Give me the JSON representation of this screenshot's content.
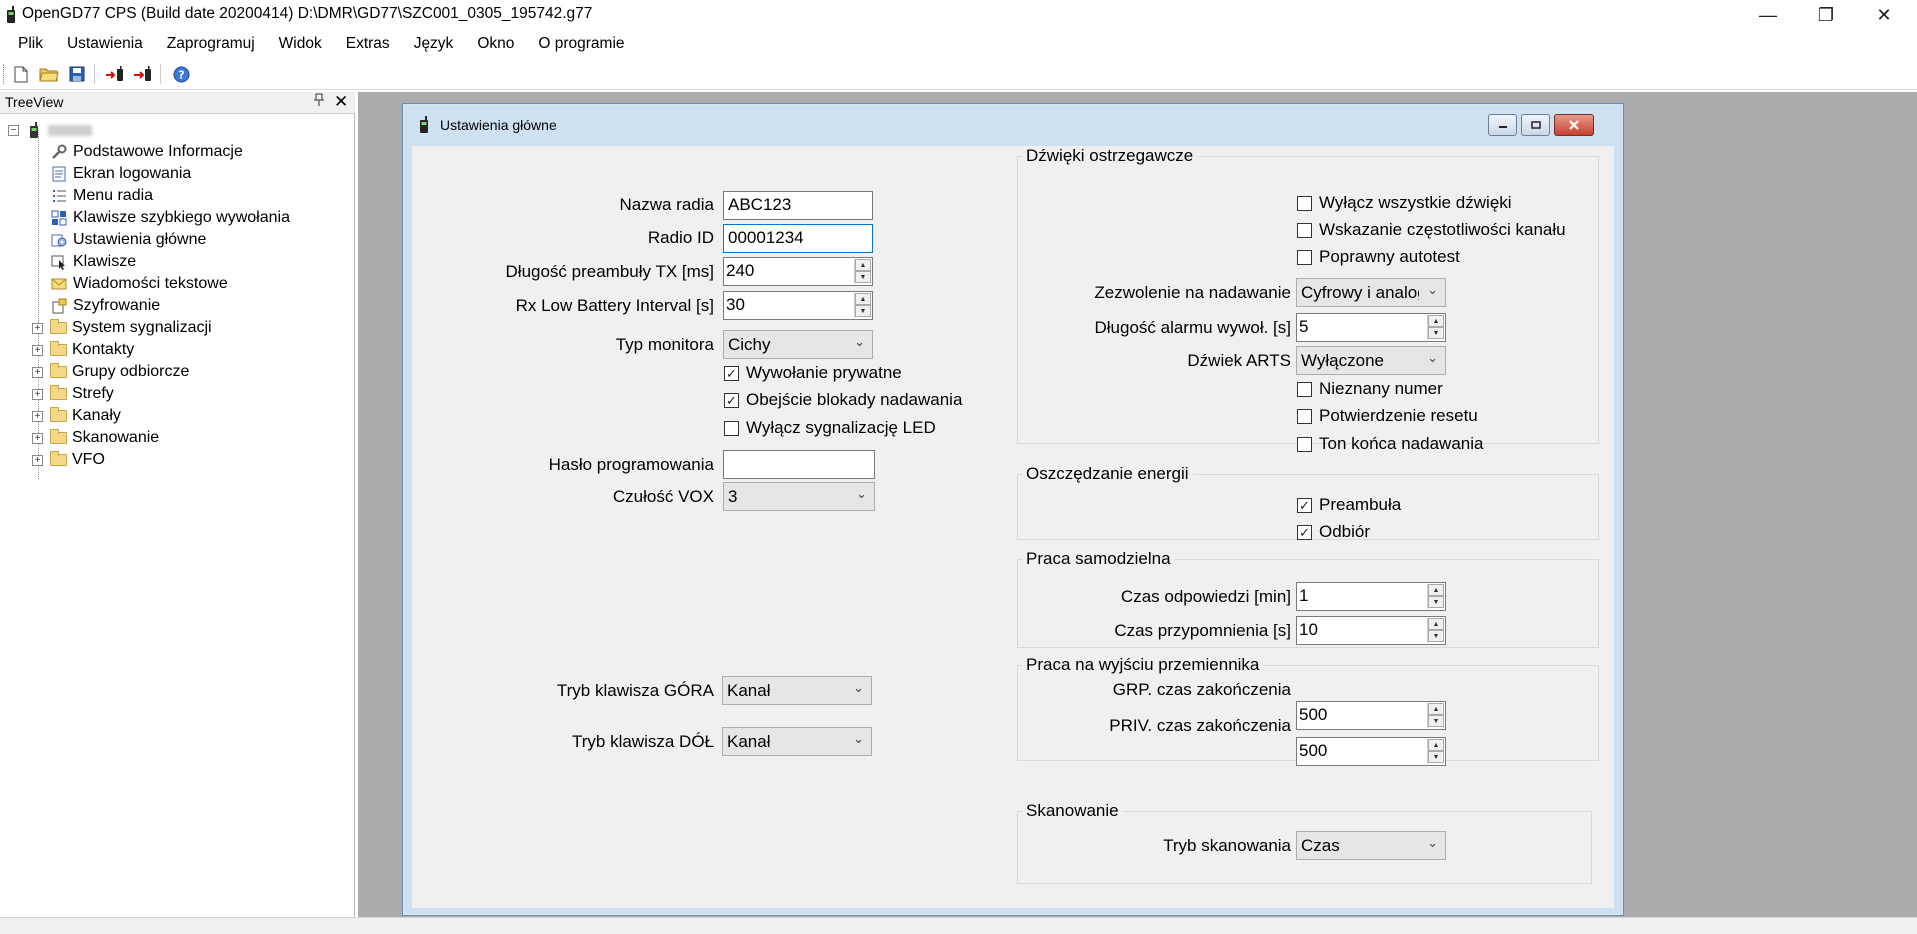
{
  "window": {
    "title": "OpenGD77 CPS (Build date 20200414) D:\\DMR\\GD77\\SZC001_0305_195742.g77",
    "minimize": "—",
    "restore": "❐",
    "close": "✕"
  },
  "menu": [
    "Plik",
    "Ustawienia",
    "Zaprogramuj",
    "Widok",
    "Extras",
    "Język",
    "Okno",
    "O programie"
  ],
  "toolbar": {
    "new_icon": "new-file-icon",
    "open_icon": "open-folder-icon",
    "save_icon": "save-disk-icon",
    "read_icon": "read-radio-icon",
    "write_icon": "write-radio-icon",
    "help_icon": "help-icon"
  },
  "treeview": {
    "header": "TreeView",
    "pin": "📌",
    "close": "✕",
    "items": [
      "Podstawowe Informacje",
      "Ekran logowania",
      "Menu radia",
      "Klawisze szybkiego wywołania",
      "Ustawienia główne",
      "Klawisze",
      "Wiadomości tekstowe",
      "Szyfrowanie"
    ],
    "folders": [
      "System sygnalizacji",
      "Kontakty",
      "Grupy odbiorcze",
      "Strefy",
      "Kanały",
      "Skanowanie",
      "VFO"
    ]
  },
  "child": {
    "title": "Ustawienia główne",
    "left": {
      "radio_name_label": "Nazwa radia",
      "radio_name_value": "ABC123",
      "radio_id_label": "Radio ID",
      "radio_id_value": "00001234",
      "preamble_label": "Długość preambuły TX [ms]",
      "preamble_value": "240",
      "rx_low_label": "Rx Low Battery Interval [s]",
      "rx_low_value": "30",
      "monitor_label": "Typ monitora",
      "monitor_value": "Cichy",
      "chk_private": "Wywołanie prywatne",
      "chk_bypass": "Obejście blokady nadawania",
      "chk_led": "Wyłącz sygnalizację LED",
      "password_label": "Hasło programowania",
      "password_value": "",
      "vox_label": "Czułość VOX",
      "vox_value": "3",
      "key_up_label": "Tryb klawisza GÓRA",
      "key_up_value": "Kanał",
      "key_down_label": "Tryb klawisza DÓŁ",
      "key_down_value": "Kanał"
    },
    "sounds": {
      "title": "Dźwięki ostrzegawcze",
      "chk_disable_all": "Wyłącz wszystkie dźwięki",
      "chk_freq": "Wskazanie częstotliwości kanału",
      "chk_selftest": "Poprawny autotest",
      "tx_permit_label": "Zezwolenie na nadawanie",
      "tx_permit_value": "Cyfrowy i analogowy",
      "alarm_label": "Długość alarmu wywoł. [s]",
      "alarm_value": "5",
      "arts_label": "Dźwiek ARTS",
      "arts_value": "Wyłączone",
      "chk_unknown": "Nieznany numer",
      "chk_reset": "Potwierdzenie resetu",
      "chk_endtx": "Ton końca nadawania"
    },
    "power": {
      "title": "Oszczędzanie energii",
      "chk_preamble": "Preambuła",
      "chk_rx": "Odbiór"
    },
    "standalone": {
      "title": "Praca samodzielna",
      "response_label": "Czas odpowiedzi [min]",
      "response_value": "1",
      "reminder_label": "Czas przypomnienia [s]",
      "reminder_value": "10"
    },
    "repeater": {
      "title": "Praca na wyjściu przemiennika",
      "grp_label": "GRP. czas zakończenia",
      "grp_value": "500",
      "priv_label": "PRIV. czas zakończenia",
      "priv_value": "500"
    },
    "scan": {
      "title": "Skanowanie",
      "mode_label": "Tryb skanowania",
      "mode_value": "Czas"
    }
  }
}
